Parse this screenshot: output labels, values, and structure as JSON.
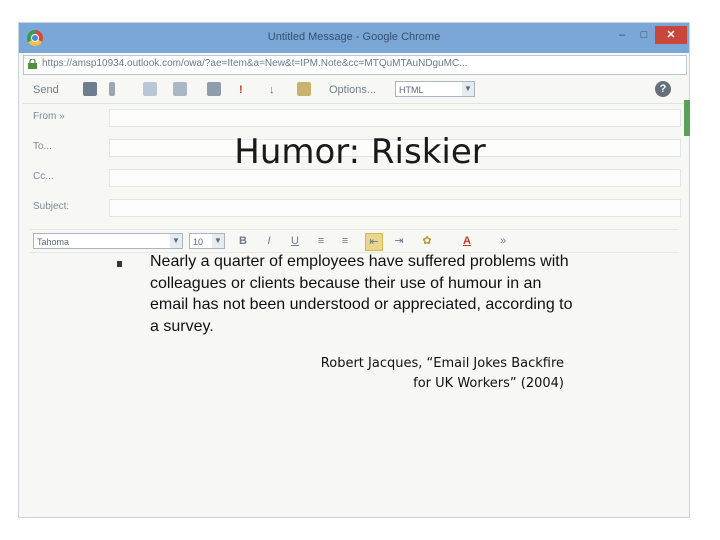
{
  "browser": {
    "window_title": "Untitled Message - Google Chrome",
    "url": "https://amsp10934.outlook.com/owa/?ae=Item&a=New&t=IPM.Note&cc=MTQuMTAuNDguMC...",
    "minimize_label": "–",
    "maximize_label": "□",
    "close_label": "✕"
  },
  "compose_toolbar": {
    "send_label": "Send",
    "options_label": "Options...",
    "format_value": "HTML",
    "help_label": "?"
  },
  "compose_fields": {
    "from_label": "From »",
    "to_label": "To...",
    "cc_label": "Cc...",
    "subject_label": "Subject:"
  },
  "format_bar": {
    "font_value": "Tahoma",
    "size_value": "10",
    "bold_label": "B",
    "italic_label": "I",
    "underline_label": "U"
  },
  "slide": {
    "title": "Humor: Riskier",
    "bullet": "Nearly a quarter of employees have suffered problems with colleagues or clients because their use of humour in an email has not been understood or appreciated, according to a survey.",
    "citation_line1": "Robert Jacques, “Email Jokes Backfire",
    "citation_line2": "for UK Workers” (2004)"
  },
  "colors": {
    "titlebar": "#7aa7d6",
    "close_button": "#c9463d",
    "highlight": "#ead58a"
  }
}
